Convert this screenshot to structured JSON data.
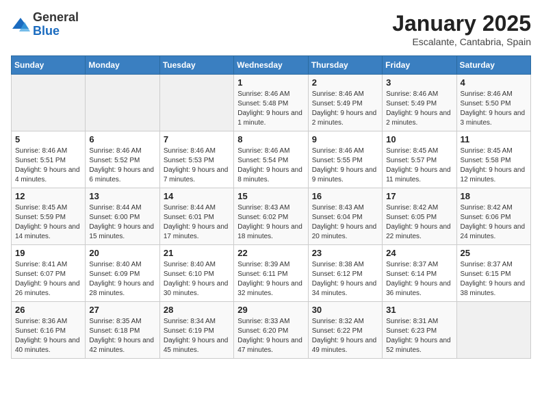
{
  "logo": {
    "general": "General",
    "blue": "Blue"
  },
  "title": "January 2025",
  "subtitle": "Escalante, Cantabria, Spain",
  "days_header": [
    "Sunday",
    "Monday",
    "Tuesday",
    "Wednesday",
    "Thursday",
    "Friday",
    "Saturday"
  ],
  "weeks": [
    [
      {
        "day": "",
        "info": ""
      },
      {
        "day": "",
        "info": ""
      },
      {
        "day": "",
        "info": ""
      },
      {
        "day": "1",
        "info": "Sunrise: 8:46 AM\nSunset: 5:48 PM\nDaylight: 9 hours\nand 1 minute."
      },
      {
        "day": "2",
        "info": "Sunrise: 8:46 AM\nSunset: 5:49 PM\nDaylight: 9 hours\nand 2 minutes."
      },
      {
        "day": "3",
        "info": "Sunrise: 8:46 AM\nSunset: 5:49 PM\nDaylight: 9 hours\nand 2 minutes."
      },
      {
        "day": "4",
        "info": "Sunrise: 8:46 AM\nSunset: 5:50 PM\nDaylight: 9 hours\nand 3 minutes."
      }
    ],
    [
      {
        "day": "5",
        "info": "Sunrise: 8:46 AM\nSunset: 5:51 PM\nDaylight: 9 hours\nand 4 minutes."
      },
      {
        "day": "6",
        "info": "Sunrise: 8:46 AM\nSunset: 5:52 PM\nDaylight: 9 hours\nand 6 minutes."
      },
      {
        "day": "7",
        "info": "Sunrise: 8:46 AM\nSunset: 5:53 PM\nDaylight: 9 hours\nand 7 minutes."
      },
      {
        "day": "8",
        "info": "Sunrise: 8:46 AM\nSunset: 5:54 PM\nDaylight: 9 hours\nand 8 minutes."
      },
      {
        "day": "9",
        "info": "Sunrise: 8:46 AM\nSunset: 5:55 PM\nDaylight: 9 hours\nand 9 minutes."
      },
      {
        "day": "10",
        "info": "Sunrise: 8:45 AM\nSunset: 5:57 PM\nDaylight: 9 hours\nand 11 minutes."
      },
      {
        "day": "11",
        "info": "Sunrise: 8:45 AM\nSunset: 5:58 PM\nDaylight: 9 hours\nand 12 minutes."
      }
    ],
    [
      {
        "day": "12",
        "info": "Sunrise: 8:45 AM\nSunset: 5:59 PM\nDaylight: 9 hours\nand 14 minutes."
      },
      {
        "day": "13",
        "info": "Sunrise: 8:44 AM\nSunset: 6:00 PM\nDaylight: 9 hours\nand 15 minutes."
      },
      {
        "day": "14",
        "info": "Sunrise: 8:44 AM\nSunset: 6:01 PM\nDaylight: 9 hours\nand 17 minutes."
      },
      {
        "day": "15",
        "info": "Sunrise: 8:43 AM\nSunset: 6:02 PM\nDaylight: 9 hours\nand 18 minutes."
      },
      {
        "day": "16",
        "info": "Sunrise: 8:43 AM\nSunset: 6:04 PM\nDaylight: 9 hours\nand 20 minutes."
      },
      {
        "day": "17",
        "info": "Sunrise: 8:42 AM\nSunset: 6:05 PM\nDaylight: 9 hours\nand 22 minutes."
      },
      {
        "day": "18",
        "info": "Sunrise: 8:42 AM\nSunset: 6:06 PM\nDaylight: 9 hours\nand 24 minutes."
      }
    ],
    [
      {
        "day": "19",
        "info": "Sunrise: 8:41 AM\nSunset: 6:07 PM\nDaylight: 9 hours\nand 26 minutes."
      },
      {
        "day": "20",
        "info": "Sunrise: 8:40 AM\nSunset: 6:09 PM\nDaylight: 9 hours\nand 28 minutes."
      },
      {
        "day": "21",
        "info": "Sunrise: 8:40 AM\nSunset: 6:10 PM\nDaylight: 9 hours\nand 30 minutes."
      },
      {
        "day": "22",
        "info": "Sunrise: 8:39 AM\nSunset: 6:11 PM\nDaylight: 9 hours\nand 32 minutes."
      },
      {
        "day": "23",
        "info": "Sunrise: 8:38 AM\nSunset: 6:12 PM\nDaylight: 9 hours\nand 34 minutes."
      },
      {
        "day": "24",
        "info": "Sunrise: 8:37 AM\nSunset: 6:14 PM\nDaylight: 9 hours\nand 36 minutes."
      },
      {
        "day": "25",
        "info": "Sunrise: 8:37 AM\nSunset: 6:15 PM\nDaylight: 9 hours\nand 38 minutes."
      }
    ],
    [
      {
        "day": "26",
        "info": "Sunrise: 8:36 AM\nSunset: 6:16 PM\nDaylight: 9 hours\nand 40 minutes."
      },
      {
        "day": "27",
        "info": "Sunrise: 8:35 AM\nSunset: 6:18 PM\nDaylight: 9 hours\nand 42 minutes."
      },
      {
        "day": "28",
        "info": "Sunrise: 8:34 AM\nSunset: 6:19 PM\nDaylight: 9 hours\nand 45 minutes."
      },
      {
        "day": "29",
        "info": "Sunrise: 8:33 AM\nSunset: 6:20 PM\nDaylight: 9 hours\nand 47 minutes."
      },
      {
        "day": "30",
        "info": "Sunrise: 8:32 AM\nSunset: 6:22 PM\nDaylight: 9 hours\nand 49 minutes."
      },
      {
        "day": "31",
        "info": "Sunrise: 8:31 AM\nSunset: 6:23 PM\nDaylight: 9 hours\nand 52 minutes."
      },
      {
        "day": "",
        "info": ""
      }
    ]
  ]
}
